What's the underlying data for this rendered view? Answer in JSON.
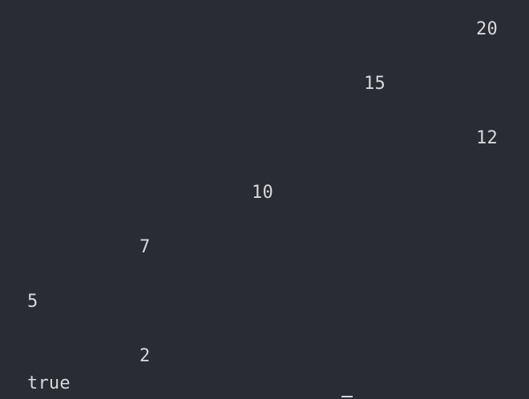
{
  "terminal": {
    "tree_nodes": [
      "20",
      "15",
      "12",
      "10",
      "7",
      "5",
      "2"
    ],
    "result": "true"
  }
}
